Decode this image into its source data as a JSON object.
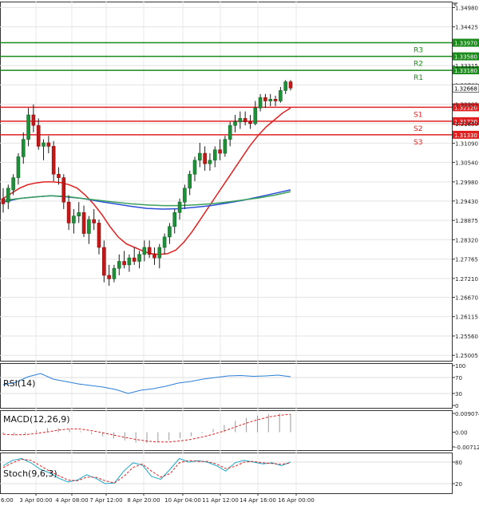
{
  "chart_data": {
    "type": "candlestick",
    "x_ticks": [
      "3 Apr 00:00",
      "4 Apr 08:00",
      "7 Apr 12:00",
      "8 Apr 20:00",
      "10 Apr 04:00",
      "11 Apr 12:00",
      "14 Apr 16:00",
      "16 Apr 00:00"
    ],
    "x_tick_partial": "6:00",
    "y_ticks": [
      "1.34980",
      "1.34425",
      "1.33315",
      "1.32760",
      "1.32205",
      "1.31650",
      "1.31090",
      "1.30540",
      "1.29980",
      "1.29430",
      "1.28875",
      "1.28320",
      "1.27765",
      "1.27210",
      "1.26670",
      "1.26115",
      "1.25560",
      "1.25005"
    ],
    "ylim": [
      1.2485,
      1.3515
    ],
    "current_price": "1.32668",
    "candles": [
      {
        "o": 1.295,
        "h": 1.298,
        "l": 1.291,
        "c": 1.2935
      },
      {
        "o": 1.294,
        "h": 1.299,
        "l": 1.292,
        "c": 1.298
      },
      {
        "o": 1.2975,
        "h": 1.302,
        "l": 1.296,
        "c": 1.301
      },
      {
        "o": 1.301,
        "h": 1.308,
        "l": 1.299,
        "c": 1.307
      },
      {
        "o": 1.307,
        "h": 1.314,
        "l": 1.305,
        "c": 1.312
      },
      {
        "o": 1.312,
        "h": 1.321,
        "l": 1.31,
        "c": 1.319
      },
      {
        "o": 1.319,
        "h": 1.322,
        "l": 1.314,
        "c": 1.316
      },
      {
        "o": 1.316,
        "h": 1.318,
        "l": 1.309,
        "c": 1.31
      },
      {
        "o": 1.31,
        "h": 1.312,
        "l": 1.306,
        "c": 1.311
      },
      {
        "o": 1.311,
        "h": 1.313,
        "l": 1.308,
        "c": 1.31
      },
      {
        "o": 1.31,
        "h": 1.3115,
        "l": 1.3,
        "c": 1.302
      },
      {
        "o": 1.302,
        "h": 1.304,
        "l": 1.299,
        "c": 1.301
      },
      {
        "o": 1.301,
        "h": 1.302,
        "l": 1.292,
        "c": 1.294
      },
      {
        "o": 1.294,
        "h": 1.296,
        "l": 1.286,
        "c": 1.288
      },
      {
        "o": 1.288,
        "h": 1.292,
        "l": 1.285,
        "c": 1.29
      },
      {
        "o": 1.29,
        "h": 1.294,
        "l": 1.288,
        "c": 1.291
      },
      {
        "o": 1.291,
        "h": 1.293,
        "l": 1.284,
        "c": 1.285
      },
      {
        "o": 1.285,
        "h": 1.29,
        "l": 1.282,
        "c": 1.289
      },
      {
        "o": 1.289,
        "h": 1.292,
        "l": 1.286,
        "c": 1.288
      },
      {
        "o": 1.288,
        "h": 1.289,
        "l": 1.279,
        "c": 1.281
      },
      {
        "o": 1.281,
        "h": 1.283,
        "l": 1.271,
        "c": 1.273
      },
      {
        "o": 1.273,
        "h": 1.276,
        "l": 1.27,
        "c": 1.272
      },
      {
        "o": 1.272,
        "h": 1.276,
        "l": 1.271,
        "c": 1.275
      },
      {
        "o": 1.275,
        "h": 1.279,
        "l": 1.273,
        "c": 1.277
      },
      {
        "o": 1.277,
        "h": 1.28,
        "l": 1.275,
        "c": 1.276
      },
      {
        "o": 1.276,
        "h": 1.279,
        "l": 1.274,
        "c": 1.278
      },
      {
        "o": 1.278,
        "h": 1.281,
        "l": 1.276,
        "c": 1.277
      },
      {
        "o": 1.277,
        "h": 1.28,
        "l": 1.275,
        "c": 1.279
      },
      {
        "o": 1.279,
        "h": 1.283,
        "l": 1.277,
        "c": 1.281
      },
      {
        "o": 1.281,
        "h": 1.283,
        "l": 1.278,
        "c": 1.279
      },
      {
        "o": 1.279,
        "h": 1.281,
        "l": 1.276,
        "c": 1.278
      },
      {
        "o": 1.278,
        "h": 1.282,
        "l": 1.275,
        "c": 1.281
      },
      {
        "o": 1.281,
        "h": 1.285,
        "l": 1.279,
        "c": 1.284
      },
      {
        "o": 1.284,
        "h": 1.288,
        "l": 1.282,
        "c": 1.287
      },
      {
        "o": 1.287,
        "h": 1.292,
        "l": 1.285,
        "c": 1.291
      },
      {
        "o": 1.291,
        "h": 1.295,
        "l": 1.289,
        "c": 1.294
      },
      {
        "o": 1.294,
        "h": 1.299,
        "l": 1.292,
        "c": 1.298
      },
      {
        "o": 1.298,
        "h": 1.303,
        "l": 1.296,
        "c": 1.302
      },
      {
        "o": 1.302,
        "h": 1.307,
        "l": 1.3,
        "c": 1.306
      },
      {
        "o": 1.306,
        "h": 1.311,
        "l": 1.304,
        "c": 1.308
      },
      {
        "o": 1.308,
        "h": 1.31,
        "l": 1.303,
        "c": 1.305
      },
      {
        "o": 1.305,
        "h": 1.308,
        "l": 1.303,
        "c": 1.306
      },
      {
        "o": 1.306,
        "h": 1.31,
        "l": 1.304,
        "c": 1.309
      },
      {
        "o": 1.309,
        "h": 1.312,
        "l": 1.306,
        "c": 1.308
      },
      {
        "o": 1.308,
        "h": 1.313,
        "l": 1.307,
        "c": 1.312
      },
      {
        "o": 1.312,
        "h": 1.317,
        "l": 1.31,
        "c": 1.316
      },
      {
        "o": 1.316,
        "h": 1.319,
        "l": 1.314,
        "c": 1.317
      },
      {
        "o": 1.317,
        "h": 1.32,
        "l": 1.315,
        "c": 1.318
      },
      {
        "o": 1.318,
        "h": 1.32,
        "l": 1.316,
        "c": 1.317
      },
      {
        "o": 1.317,
        "h": 1.319,
        "l": 1.315,
        "c": 1.3165
      },
      {
        "o": 1.3165,
        "h": 1.323,
        "l": 1.316,
        "c": 1.321
      },
      {
        "o": 1.321,
        "h": 1.325,
        "l": 1.32,
        "c": 1.324
      },
      {
        "o": 1.324,
        "h": 1.325,
        "l": 1.321,
        "c": 1.323
      },
      {
        "o": 1.323,
        "h": 1.325,
        "l": 1.3215,
        "c": 1.3235
      },
      {
        "o": 1.3235,
        "h": 1.3245,
        "l": 1.3215,
        "c": 1.323
      },
      {
        "o": 1.323,
        "h": 1.327,
        "l": 1.3225,
        "c": 1.326
      },
      {
        "o": 1.326,
        "h": 1.329,
        "l": 1.325,
        "c": 1.3285
      },
      {
        "o": 1.3285,
        "h": 1.329,
        "l": 1.326,
        "c": 1.3267
      }
    ],
    "levels": [
      {
        "name": "R3",
        "value": 1.3397,
        "label": "1.33970",
        "color": "#1a8a1a"
      },
      {
        "name": "R2",
        "value": 1.3358,
        "label": "1.33580",
        "color": "#1a8a1a"
      },
      {
        "name": "R1",
        "value": 1.3318,
        "label": "1.33180",
        "color": "#1a8a1a"
      },
      {
        "name": "S1",
        "value": 1.3212,
        "label": "1.32120",
        "color": "#e02020"
      },
      {
        "name": "S2",
        "value": 1.3172,
        "label": "1.31720",
        "color": "#e02020"
      },
      {
        "name": "S3",
        "value": 1.3133,
        "label": "1.31330",
        "color": "#e02020"
      }
    ],
    "moving_averages": [
      {
        "color": "#e02020",
        "values": [
          1.295,
          1.2965,
          1.298,
          1.299,
          1.2995,
          1.2998,
          1.2998,
          1.2996,
          1.299,
          1.298,
          1.296,
          1.2935,
          1.2905,
          1.287,
          1.284,
          1.282,
          1.281,
          1.28,
          1.2792,
          1.279,
          1.2792,
          1.2802,
          1.2825,
          1.2855,
          1.289,
          1.2925,
          1.296,
          1.2995,
          1.303,
          1.3065,
          1.31,
          1.313,
          1.3155,
          1.3175,
          1.3195,
          1.321
        ]
      },
      {
        "color": "#2a4ed8",
        "values": [
          1.294,
          1.295,
          1.2955,
          1.2958,
          1.2955,
          1.295,
          1.2942,
          1.2935,
          1.2928,
          1.2922,
          1.292,
          1.2921,
          1.2925,
          1.293,
          1.2937,
          1.2945,
          1.2955,
          1.2965,
          1.2975
        ]
      },
      {
        "color": "#3aa05a",
        "values": [
          1.2945,
          1.295,
          1.2955,
          1.2958,
          1.2956,
          1.295,
          1.2945,
          1.294,
          1.2935,
          1.2932,
          1.293,
          1.293,
          1.2932,
          1.2935,
          1.294,
          1.2946,
          1.2952,
          1.296,
          1.297
        ]
      }
    ],
    "rsi": {
      "label": "RSI(14)",
      "ticks": [
        "100",
        "70",
        "30",
        "0"
      ],
      "values": [
        52,
        58,
        72,
        80,
        66,
        60,
        54,
        50,
        46,
        40,
        30,
        38,
        42,
        48,
        56,
        60,
        66,
        70,
        74,
        75,
        73,
        74,
        76,
        72
      ]
    },
    "macd": {
      "label": "MACD(12,26,9)",
      "ticks": [
        "0.009074",
        "0.00",
        "-0.007124"
      ],
      "values": [
        -0.001,
        -0.0015,
        -0.001,
        0.001,
        0.002,
        0.002,
        0.0015,
        0.0005,
        -0.001,
        -0.002,
        -0.003,
        -0.004,
        -0.005,
        -0.0052,
        -0.0048,
        -0.004,
        -0.003,
        -0.002,
        -0.0005,
        0.0015,
        0.0035,
        0.0055,
        0.007,
        0.008,
        0.0088,
        0.009,
        0.0088
      ]
    },
    "stoch": {
      "label": "Stoch(9,6,3)",
      "ticks": [
        "80",
        "20"
      ],
      "main": [
        70,
        85,
        90,
        78,
        60,
        50,
        35,
        25,
        30,
        45,
        35,
        20,
        22,
        55,
        78,
        72,
        40,
        32,
        60,
        90,
        80,
        84,
        80,
        70,
        55,
        78,
        85,
        80,
        75,
        78,
        70,
        80
      ],
      "signal": [
        65,
        78,
        88,
        85,
        70,
        55,
        42,
        30,
        28,
        38,
        38,
        28,
        22,
        40,
        65,
        75,
        55,
        38,
        48,
        78,
        85,
        82,
        82,
        75,
        62,
        68,
        80,
        82,
        78,
        76,
        74,
        78
      ]
    }
  }
}
